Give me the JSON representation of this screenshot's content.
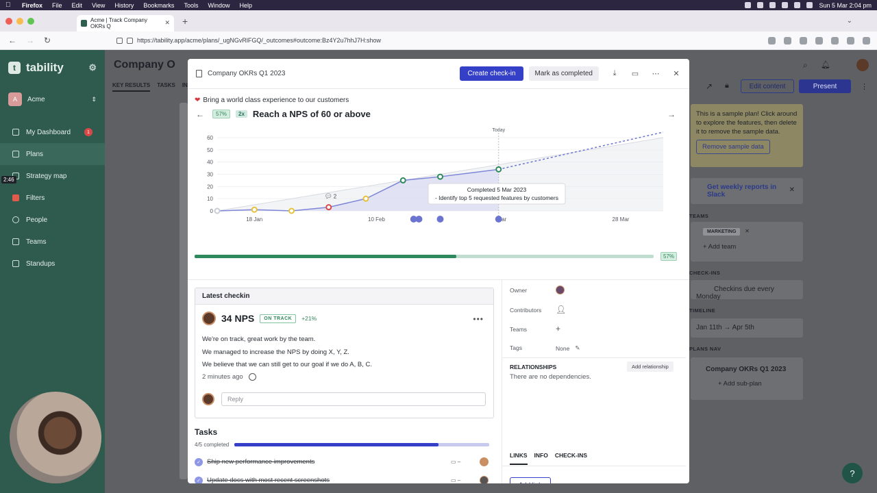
{
  "menubar": {
    "app": "Firefox",
    "items": [
      "File",
      "Edit",
      "View",
      "History",
      "Bookmarks",
      "Tools",
      "Window",
      "Help"
    ],
    "datetime": "Sun 5 Mar  2:04 pm"
  },
  "browser": {
    "tab_title": "Acme | Track Company OKRs Q",
    "url": "https://tability.app/acme/plans/_ugNGvRlFGQ/_outcomes#outcome:Bz4Y2u7hhJ7H:show"
  },
  "sidebar": {
    "brand": "tability",
    "workspace_initial": "A",
    "workspace": "Acme",
    "items": [
      {
        "label": "My Dashboard",
        "badge": "1"
      },
      {
        "label": "Plans"
      },
      {
        "label": "Strategy map"
      },
      {
        "label": "Filters"
      },
      {
        "label": "People"
      },
      {
        "label": "Teams"
      },
      {
        "label": "Standups"
      }
    ],
    "timer": "2:46"
  },
  "background_page": {
    "title": "Company O",
    "tabs": [
      "KEY RESULTS",
      "TASKS",
      "IN"
    ],
    "edit_content": "Edit content",
    "present": "Present",
    "sample_note": "This is a sample plan! Click around to explore the features, then delete it to remove the sample data.",
    "remove_sample": "Remove sample data",
    "slack": "Get weekly reports in Slack",
    "teams_label": "TEAMS",
    "team_tag": "MARKETING",
    "add_team": "Add team",
    "checkins_label": "CHECK-INS",
    "checkins": "Checkins due every Monday",
    "timeline_label": "TIMELINE",
    "timeline": "Jan 11th → Apr 5th",
    "plansnav_label": "PLANS NAV",
    "plan_link": "Company OKRs Q1 2023",
    "add_subplan": "Add sub-plan"
  },
  "modal": {
    "plan_name": "Company OKRs Q1 2023",
    "create_checkin": "Create check-in",
    "mark_completed": "Mark as completed",
    "objective": "Bring a world class experience to our customers",
    "kr_progress_pill": "57%",
    "kr_multiplier": "2x",
    "kr_title": "Reach a NPS of 60 or above",
    "progress_pct": 0.57,
    "progress_label": "57%",
    "latest_checkin": {
      "header": "Latest checkin",
      "score": "34 NPS",
      "status": "ON TRACK",
      "delta": "+21%",
      "lines": [
        "We're on track, great work by the team.",
        "We managed to increase the NPS by doing X, Y, Z.",
        "We believe that we can still get to our goal if we do A, B, C."
      ],
      "ago": "2 minutes ago",
      "reply_placeholder": "Reply"
    },
    "tasks": {
      "title": "Tasks",
      "completed_label": "4/5 completed",
      "completed_fraction": 0.8,
      "items": [
        {
          "label": "Ship new performance improvements",
          "date": "–"
        },
        {
          "label": "Update docs with most recent screenshots",
          "date": "–"
        }
      ]
    },
    "side": {
      "owner_label": "Owner",
      "contributors_label": "Contributors",
      "teams_label": "Teams",
      "tags_label": "Tags",
      "tags_value": "None",
      "relationships_label": "RELATIONSHIPS",
      "add_relationship": "Add relationship",
      "dependencies": "There are no dependencies.",
      "tabs": [
        "LINKS",
        "INFO",
        "CHECK-INS"
      ],
      "add_link": "Add link"
    }
  },
  "chart_data": {
    "type": "line",
    "today_label": "Today",
    "ylim": [
      0,
      60
    ],
    "yticks": [
      0,
      10,
      20,
      30,
      40,
      50,
      60
    ],
    "x_ticks": [
      "18 Jan",
      "10 Feb",
      "28 Mar"
    ],
    "x_tick_partial": "ar",
    "checkins": [
      {
        "date": "2023-01-11",
        "value": 0,
        "status": "none"
      },
      {
        "date": "2023-01-18",
        "value": 1,
        "status": "yellow"
      },
      {
        "date": "2023-01-25",
        "value": 0,
        "status": "yellow"
      },
      {
        "date": "2023-02-01",
        "value": 3,
        "status": "red"
      },
      {
        "date": "2023-02-08",
        "value": 10,
        "status": "yellow"
      },
      {
        "date": "2023-02-15",
        "value": 25,
        "status": "green"
      },
      {
        "date": "2023-02-22",
        "value": 28,
        "status": "green"
      },
      {
        "date": "2023-03-05",
        "value": 34,
        "status": "green"
      }
    ],
    "comment_count": "2",
    "tooltip": {
      "title": "Completed 5 Mar 2023",
      "detail": "- Identify top 5 requested features by customers"
    },
    "colors": {
      "line": "#7f86d8",
      "area": "#d9dcf4",
      "target": "#e8e9ee",
      "green": "#2e8a5c",
      "yellow": "#e5c23b",
      "red": "#d94848",
      "proj": "#6b74d0"
    }
  }
}
